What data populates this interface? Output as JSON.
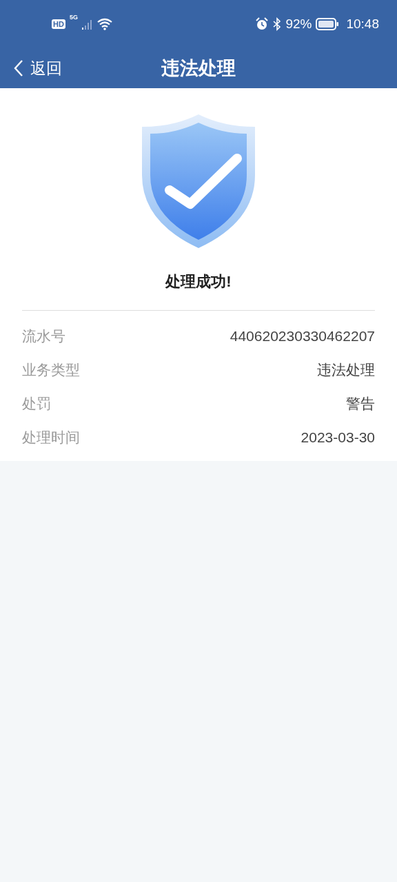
{
  "status_bar": {
    "hd": "HD",
    "network": "5G",
    "battery": "92%",
    "time": "10:48"
  },
  "nav": {
    "back": "返回",
    "title": "违法处理"
  },
  "result": {
    "message": "处理成功!"
  },
  "details": [
    {
      "label": "流水号",
      "value": "440620230330462207"
    },
    {
      "label": "业务类型",
      "value": "违法处理"
    },
    {
      "label": "处罚",
      "value": "警告"
    },
    {
      "label": "处理时间",
      "value": "2023-03-30"
    }
  ]
}
